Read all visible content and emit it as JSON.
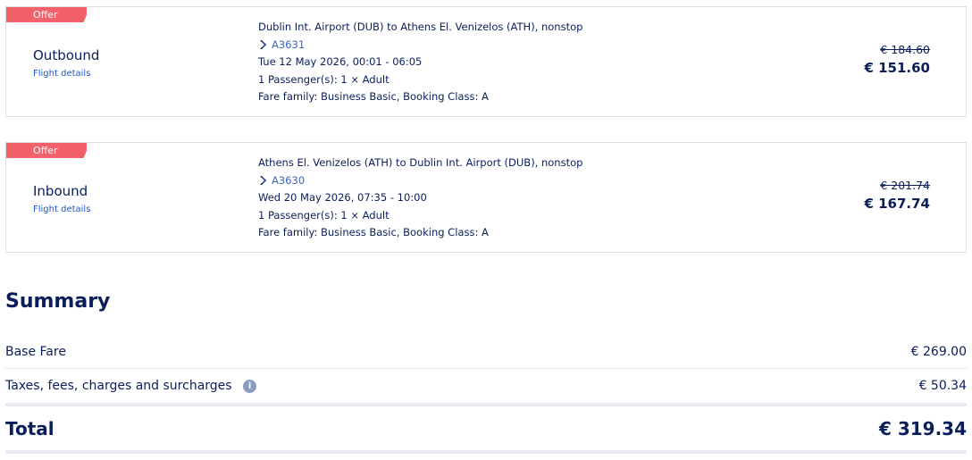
{
  "outbound": {
    "offer_label": "Offer",
    "direction": "Outbound",
    "flight_details_link": "Flight details",
    "route": "Dublin Int. Airport (DUB) to Athens El. Venizelos (ATH), nonstop",
    "flight_number": "A3631",
    "datetime": "Tue 12 May 2026, 00:01 - 06:05",
    "passengers": "1 Passenger(s): 1 × Adult",
    "fare_family": "Fare family: Business Basic, Booking Class: A",
    "old_price": "€ 184.60",
    "new_price": "€ 151.60"
  },
  "inbound": {
    "offer_label": "Offer",
    "direction": "Inbound",
    "flight_details_link": "Flight details",
    "route": "Athens El. Venizelos (ATH) to Dublin Int. Airport (DUB), nonstop",
    "flight_number": "A3630",
    "datetime": "Wed 20 May 2026, 07:35 - 10:00",
    "passengers": "1 Passenger(s): 1 × Adult",
    "fare_family": "Fare family: Business Basic, Booking Class: A",
    "old_price": "€ 201.74",
    "new_price": "€ 167.74"
  },
  "summary": {
    "title": "Summary",
    "base_fare_label": "Base Fare",
    "base_fare_value": "€ 269.00",
    "taxes_label": "Taxes, fees, charges and surcharges",
    "taxes_value": "€ 50.34",
    "total_label": "Total",
    "total_value": "€ 319.34"
  },
  "icons": {
    "flight_icon": "airline-chevron-icon",
    "info_icon": "info-icon"
  },
  "colors": {
    "offer_ribbon": "#f2606a",
    "text_primary": "#0a1e5a",
    "link": "#1a57c9"
  }
}
